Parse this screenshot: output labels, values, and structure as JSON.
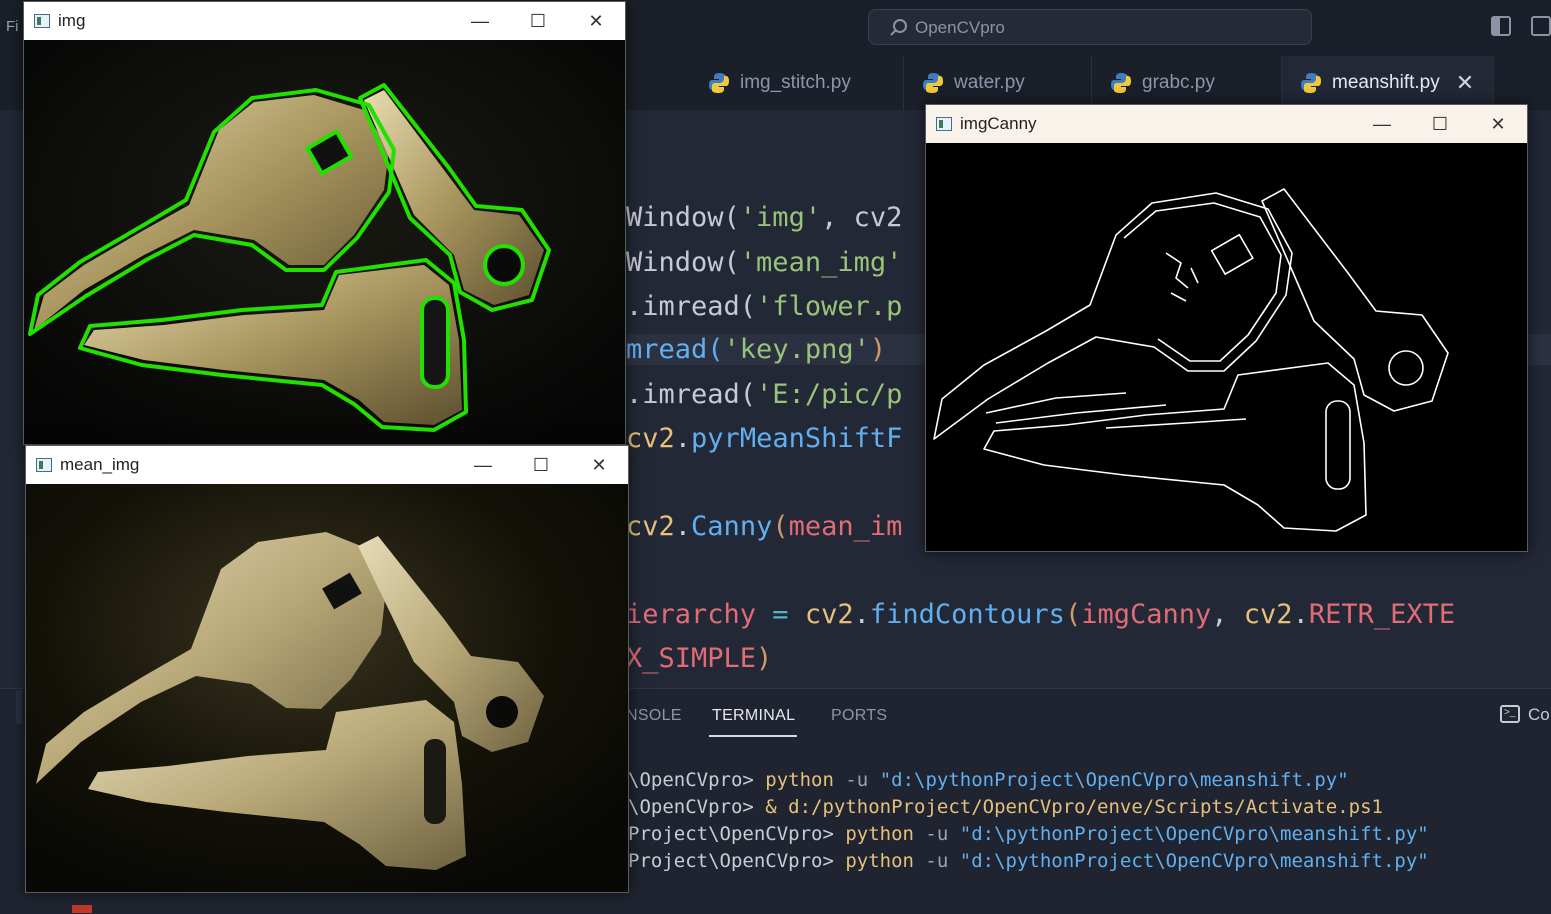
{
  "titlebar": {
    "menu_fragment": "Fi",
    "search_text": "OpenCVpro"
  },
  "tabs": [
    {
      "label": "img_stitch.py",
      "icon": "python-icon"
    },
    {
      "label": "water.py",
      "icon": "python-icon"
    },
    {
      "label": "grabc.py",
      "icon": "python-icon"
    },
    {
      "label": "meanshift.py",
      "icon": "python-icon",
      "active": true,
      "close": "✕"
    }
  ],
  "code": {
    "l1": [
      "Window(",
      "'img'",
      ", cv2"
    ],
    "l2": [
      "Window(",
      "'mean_img'"
    ],
    "l3": [
      ".imread(",
      "'flower.p"
    ],
    "l4": [
      "mread(",
      "'key.png'",
      ")"
    ],
    "l5": [
      ".imread(",
      "'E:/pic/p"
    ],
    "l6": [
      "cv2",
      ".",
      "pyrMeanShiftF"
    ],
    "l7": [
      "cv2",
      ".",
      "Canny",
      "(",
      "mean_im"
    ],
    "l8": [
      "ierarchy",
      " = ",
      "cv2",
      ".",
      "findContours",
      "(",
      "imgCanny",
      ", ",
      "cv2",
      ".",
      "RETR_EXTE"
    ],
    "l9": [
      "X_SIMPLE",
      ")"
    ]
  },
  "panel": {
    "tabs": [
      "NSOLE",
      "TERMINAL",
      "PORTS"
    ],
    "active_tab": "TERMINAL",
    "new_terminal_label": "Co",
    "lines": [
      {
        "prompt": "\\OpenCVpro> ",
        "cmd": "python",
        "flag": " -u ",
        "arg": "\"d:\\pythonProject\\OpenCVpro\\meanshift.py\""
      },
      {
        "prompt": "\\OpenCVpro> ",
        "cmd": "& ",
        "flag": "",
        "arg": "d:/pythonProject/OpenCVpro/enve/Scripts/Activate.ps1"
      },
      {
        "prompt": "Project\\OpenCVpro> ",
        "cmd": "python",
        "flag": " -u ",
        "arg": "\"d:\\pythonProject\\OpenCVpro\\meanshift.py\""
      },
      {
        "prompt": "Project\\OpenCVpro> ",
        "cmd": "python",
        "flag": " -u ",
        "arg": "\"d:\\pythonProject\\OpenCVpro\\meanshift.py\""
      }
    ]
  },
  "windows": {
    "img": {
      "title": "img"
    },
    "mean_img": {
      "title": "mean_img"
    },
    "imgCanny": {
      "title": "imgCanny"
    },
    "controls": {
      "minimize": "—",
      "maximize": "☐",
      "close": "✕"
    }
  },
  "colors": {
    "contour": "#22e000",
    "key_metal": "#c9b98a",
    "canny_edge": "#ffffff"
  }
}
